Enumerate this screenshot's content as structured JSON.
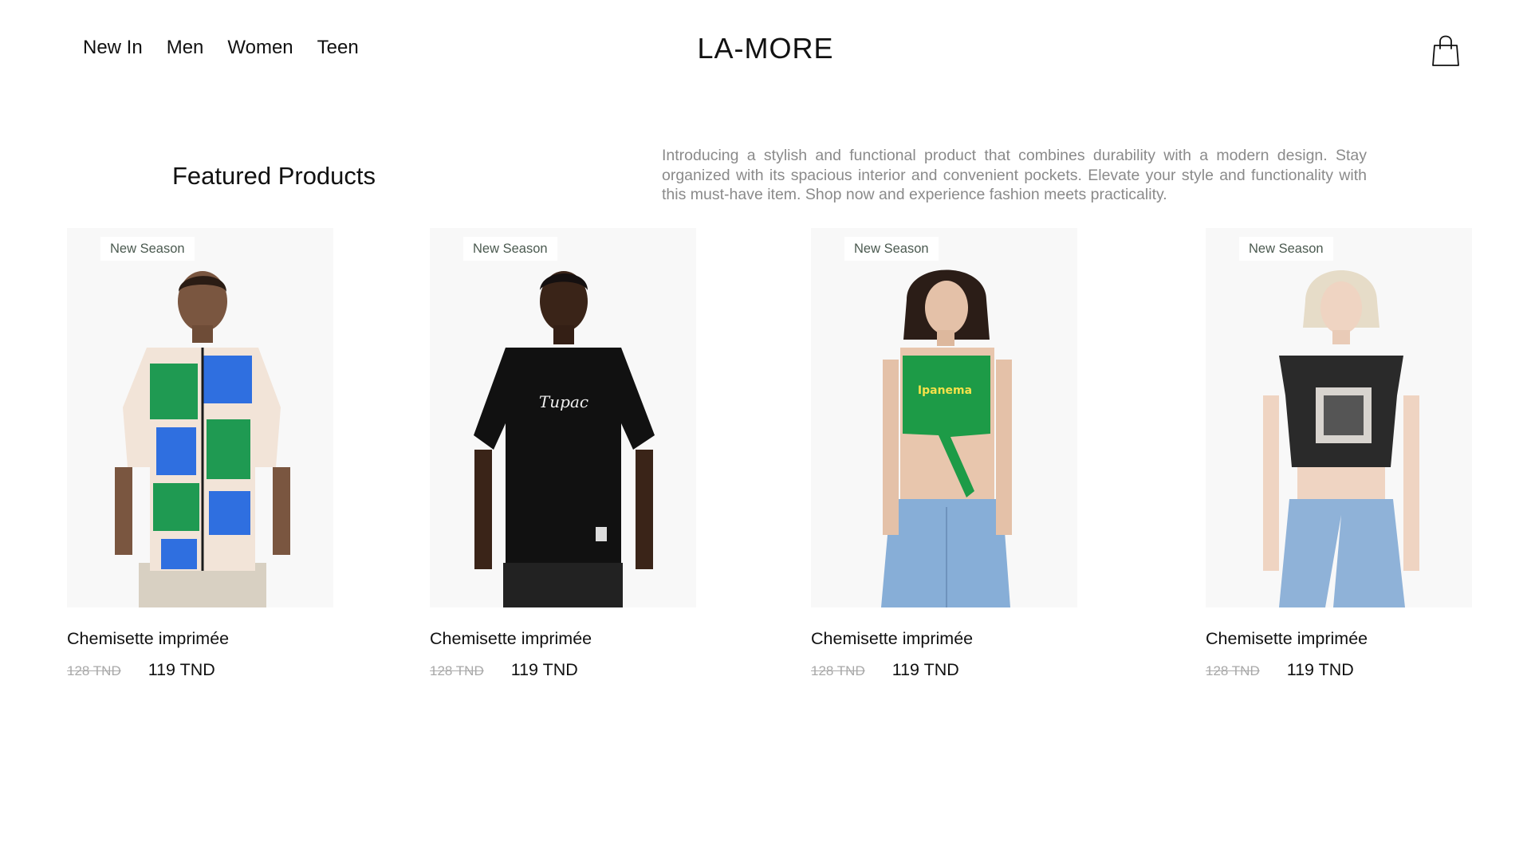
{
  "nav": {
    "items": [
      {
        "label": "New In"
      },
      {
        "label": "Men"
      },
      {
        "label": "Women"
      },
      {
        "label": "Teen"
      }
    ]
  },
  "brand": {
    "name": "LA-MORE"
  },
  "header": {
    "cart_icon": "shopping-bag-icon"
  },
  "featured": {
    "title": "Featured Products",
    "description": "Introducing a stylish and functional product that combines durability with a modern design. Stay organized with its spacious interior and convenient pockets. Elevate your style and functionality with this must-have item. Shop now and experience fashion meets practicality."
  },
  "products": [
    {
      "badge": "New Season",
      "name": "Chemisette imprimée",
      "old_price": "128 TND",
      "price": "119 TND",
      "image": "man-printed-shirt-photo"
    },
    {
      "badge": "New Season",
      "name": "Chemisette imprimée",
      "old_price": "128 TND",
      "price": "119 TND",
      "image": "man-black-tshirt-photo"
    },
    {
      "badge": "New Season",
      "name": "Chemisette imprimée",
      "old_price": "128 TND",
      "price": "119 TND",
      "image": "woman-green-top-photo"
    },
    {
      "badge": "New Season",
      "name": "Chemisette imprimée",
      "old_price": "128 TND",
      "price": "119 TND",
      "image": "woman-black-crop-top-photo"
    }
  ],
  "colors": {
    "text": "#111111",
    "muted": "#8a8a8a",
    "old_price": "#a9a9a9",
    "badge_text": "#4b5a50",
    "card_bg": "#f8f8f8"
  }
}
